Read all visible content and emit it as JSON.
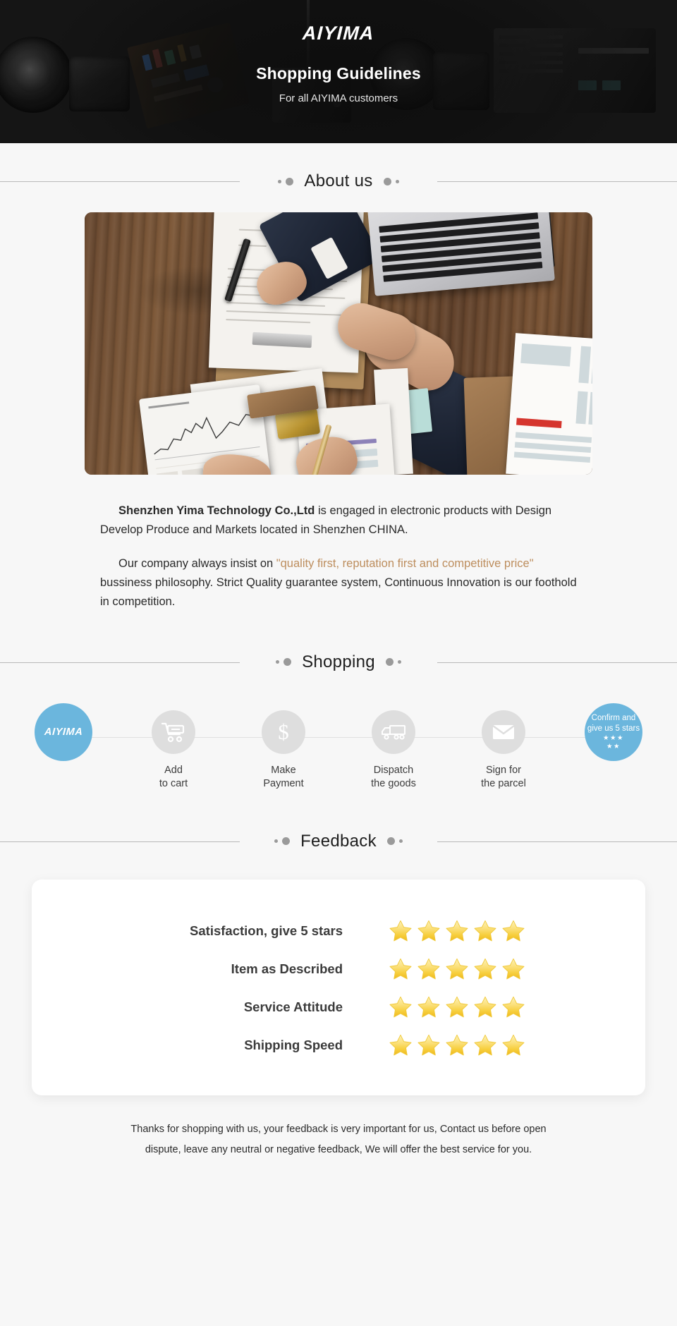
{
  "banner": {
    "logo": "AIYIMA",
    "title": "Shopping Guidelines",
    "subtitle": "For all AIYIMA customers"
  },
  "sections": {
    "about": "About us",
    "shopping": "Shopping",
    "feedback": "Feedback"
  },
  "about": {
    "p1_strong": "Shenzhen Yima Technology Co.,Ltd",
    "p1_rest": " is engaged in electronic products with Design Develop Produce and Markets located in Shenzhen CHINA.",
    "p2_pre": "Our company always insist on ",
    "p2_quote": "\"quality first, reputation first and competitive price\"",
    "p2_post": " bussiness philosophy. Strict Quality guarantee system, Continuous Innovation is our foothold in competition."
  },
  "steps": [
    {
      "id": "brand",
      "icon": "aiyima-logo-icon",
      "logo": "AIYIMA",
      "label": ""
    },
    {
      "id": "cart",
      "icon": "shopping-cart-icon",
      "label_line1": "Add",
      "label_line2": "to cart"
    },
    {
      "id": "payment",
      "icon": "dollar-icon",
      "label_line1": "Make",
      "label_line2": "Payment"
    },
    {
      "id": "dispatch",
      "icon": "truck-icon",
      "label_line1": "Dispatch",
      "label_line2": "the goods"
    },
    {
      "id": "sign",
      "icon": "envelope-icon",
      "label_line1": "Sign for",
      "label_line2": "the parcel"
    },
    {
      "id": "confirm",
      "icon": "five-stars-icon",
      "line1": "Confirm and",
      "line2": "give us 5 stars",
      "stars_row1": "★★★",
      "stars_row2": "★★"
    }
  ],
  "feedback_rows": [
    {
      "label": "Satisfaction, give 5 stars",
      "stars": 5
    },
    {
      "label": "Item as Described",
      "stars": 5
    },
    {
      "label": "Service Attitude",
      "stars": 5
    },
    {
      "label": "Shipping Speed",
      "stars": 5
    }
  ],
  "footer": {
    "line1": "Thanks for shopping with us, your feedback is very important for us, Contact us before open",
    "line2": "dispute, leave any neutral or negative feedback, We will offer the best service for you."
  },
  "colors": {
    "banner_bg": "#151515",
    "page_bg": "#f7f7f7",
    "accent_blue": "#6bb6dd",
    "quote_tan": "#bd8e5e",
    "star_gold": "#f6d04c",
    "circle_gray": "#dedede"
  }
}
